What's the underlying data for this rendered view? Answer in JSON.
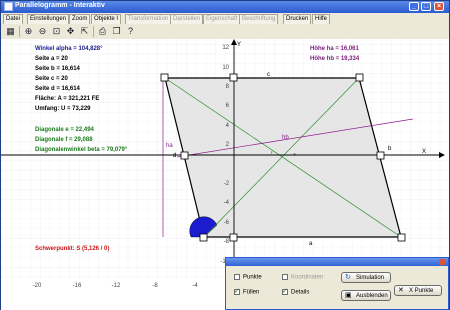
{
  "window": {
    "title": "Parallelogramm - Interaktiv"
  },
  "menu": [
    {
      "label": "Datei",
      "disabled": false
    },
    {
      "label": "Einstellungen",
      "disabled": false
    },
    {
      "label": "Zoom",
      "disabled": false
    },
    {
      "label": "Objekte I",
      "disabled": false
    },
    {
      "label": "Transformation",
      "disabled": true
    },
    {
      "label": "Darstellen",
      "disabled": true
    },
    {
      "label": "Eigenschaft",
      "disabled": true
    },
    {
      "label": "Beschriftung",
      "disabled": true
    },
    {
      "label": "Drucken",
      "disabled": false
    },
    {
      "label": "Hilfe",
      "disabled": false
    }
  ],
  "toolbar_icons": [
    "grid-icon",
    "zoom-in-icon",
    "zoom-out-icon",
    "zoom-fit-icon",
    "move-icon",
    "select-icon",
    "print-icon",
    "copy-icon",
    "help-icon"
  ],
  "info": {
    "alpha": "Winkel alpha = 104,828°",
    "seite_a": "Seite a = 20",
    "seite_b": "Seite b = 16,614",
    "seite_c": "Seite c = 20",
    "seite_d": "Seite d = 16,614",
    "flaeche": "Fläche: A = 321,221 FE",
    "umfang": "Umfang: U = 73,229",
    "diag_e": "Diagonale e = 22,494",
    "diag_f": "Diagonale f = 29,088",
    "diag_winkel": "Diagonalenwinkel beta = 79,079°",
    "hoehe_ha": "Höhe ha = 16,061",
    "hoehe_hb": "Höhe hb = 19,334",
    "schwerpunkt": "Schwerpunkt: S (5,126 / 0)"
  },
  "axes": {
    "x_label": "X",
    "y_label": "Y",
    "x_ticks": [
      "-20",
      "-16",
      "-12",
      "-8",
      "-4",
      "4",
      "8",
      "12",
      "16",
      "20",
      "24"
    ],
    "y_ticks": [
      "12",
      "10",
      "8",
      "6",
      "4",
      "2",
      "-2",
      "-4",
      "-6",
      "-8",
      "-10"
    ]
  },
  "labels": {
    "a": "a",
    "b": "b",
    "c": "c",
    "d": "d",
    "e": "e",
    "f": "f",
    "ha": "ha",
    "hb": "hb"
  },
  "colors": {
    "info_blue": "#1b1b8c",
    "info_green": "#1c7a1c",
    "info_red": "#c81818",
    "info_purple": "#7a1a7a",
    "fill": "#e6e6e6",
    "angle": "#1b1bd0"
  },
  "dialog": {
    "punkte": "Punkte",
    "koordinaten": "Koordinaten",
    "fuellen": "Füllen",
    "details": "Details",
    "simulation": "Simulation",
    "ausblenden": "Ausblenden",
    "x_punkte": "X Punkte"
  }
}
